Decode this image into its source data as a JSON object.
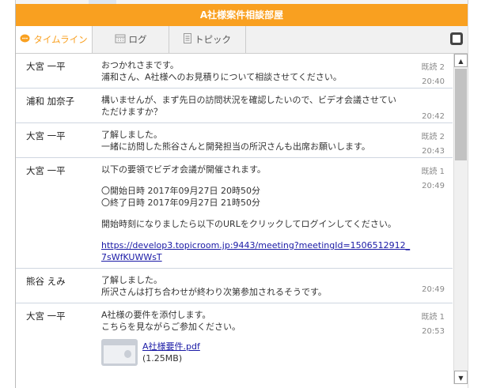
{
  "header": {
    "title": "A社様案件相談部屋"
  },
  "tabs": [
    {
      "label": "タイムライン",
      "icon": "speech-bubble-icon"
    },
    {
      "label": "ログ",
      "icon": "calendar-icon"
    },
    {
      "label": "トピック",
      "icon": "document-icon"
    }
  ],
  "messages": [
    {
      "name": "大宮 一平",
      "lines": [
        "おつかれさまです。",
        "浦和さん、A社様へのお見積りについて相談させてください。"
      ],
      "read": "既読 2",
      "time": "20:40"
    },
    {
      "name": "浦和 加奈子",
      "lines": [
        "構いませんが、まず先日の訪問状況を確認したいので、ビデオ会議させてい",
        "ただけますか？"
      ],
      "read": "",
      "time": "20:42"
    },
    {
      "name": "大宮 一平",
      "lines": [
        "了解しました。",
        "一緒に訪問した熊谷さんと開発担当の所沢さんも出席お願いします。"
      ],
      "read": "既読 2",
      "time": "20:43"
    },
    {
      "name": "大宮 一平",
      "lines": [
        "以下の要領でビデオ会議が開催されます。",
        "〇開始日時 2017年09月27日  20時50分",
        "〇終了日時 2017年09月27日  21時50分",
        "開始時刻になりましたら以下のURLをクリックしてログインしてください。"
      ],
      "link": "https://develop3.topicroom.jp:9443/meeting?meetingId=1506512912_7sWfKUWWsT",
      "read": "既読 1",
      "time": "20:49"
    },
    {
      "name": "熊谷 えみ",
      "lines": [
        "了解しました。",
        "所沢さんは打ち合わせが終わり次第参加されるそうです。"
      ],
      "read": "",
      "time": "20:49"
    },
    {
      "name": "大宮 一平",
      "lines": [
        "A社様の要件を添付します。",
        "こちらを見ながらご参加ください。"
      ],
      "file": {
        "name": "A社様要件.pdf",
        "size": "(1.25MB)"
      },
      "read": "既読 1",
      "time": "20:53"
    }
  ]
}
